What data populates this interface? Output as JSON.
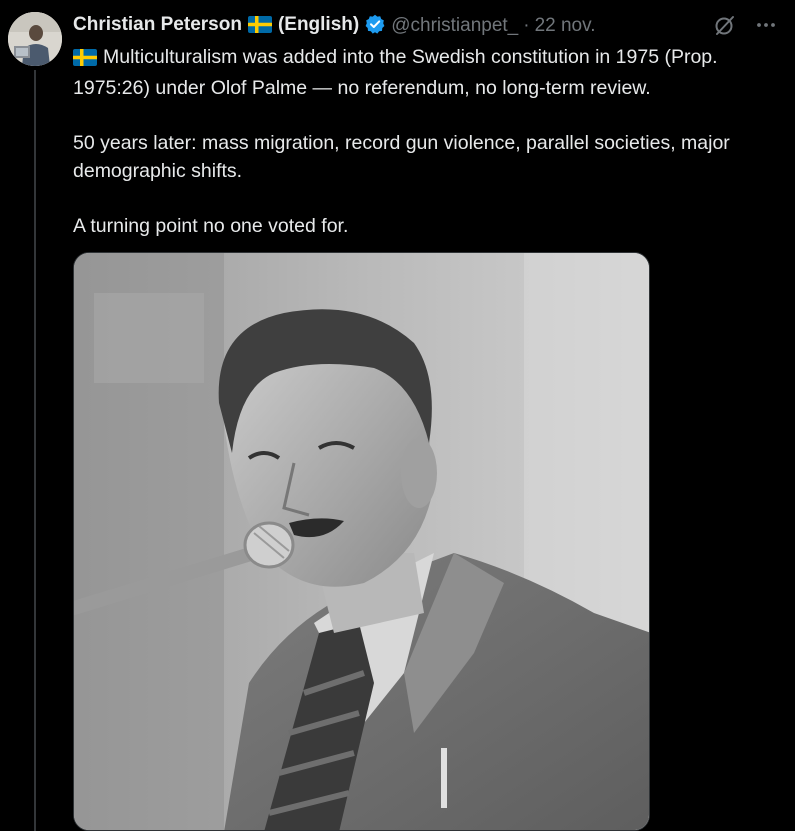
{
  "tweet": {
    "author_name": "Christian Peterson",
    "author_tag": "(English)",
    "handle": "@christianpet_",
    "separator": "·",
    "date": "22 nov.",
    "paragraphs": [
      "Multiculturalism was added into the Swedish constitution in 1975 (Prop. 1975:26) under Olof Palme — no referendum, no long-term review.",
      "50 years later: mass migration, record gun violence, parallel societies, major demographic shifts.",
      "A turning point no one voted for."
    ],
    "more_label": "···"
  },
  "icons": {
    "flag": "sweden-flag-icon",
    "verified": "verified-badge-icon",
    "grok": "grok-icon",
    "more": "more-icon"
  },
  "colors": {
    "background": "#000000",
    "text": "#e7e9ea",
    "muted": "#71767b",
    "verified": "#1d9bf0",
    "flag_blue": "#006aa7",
    "flag_yellow": "#fecc02"
  }
}
